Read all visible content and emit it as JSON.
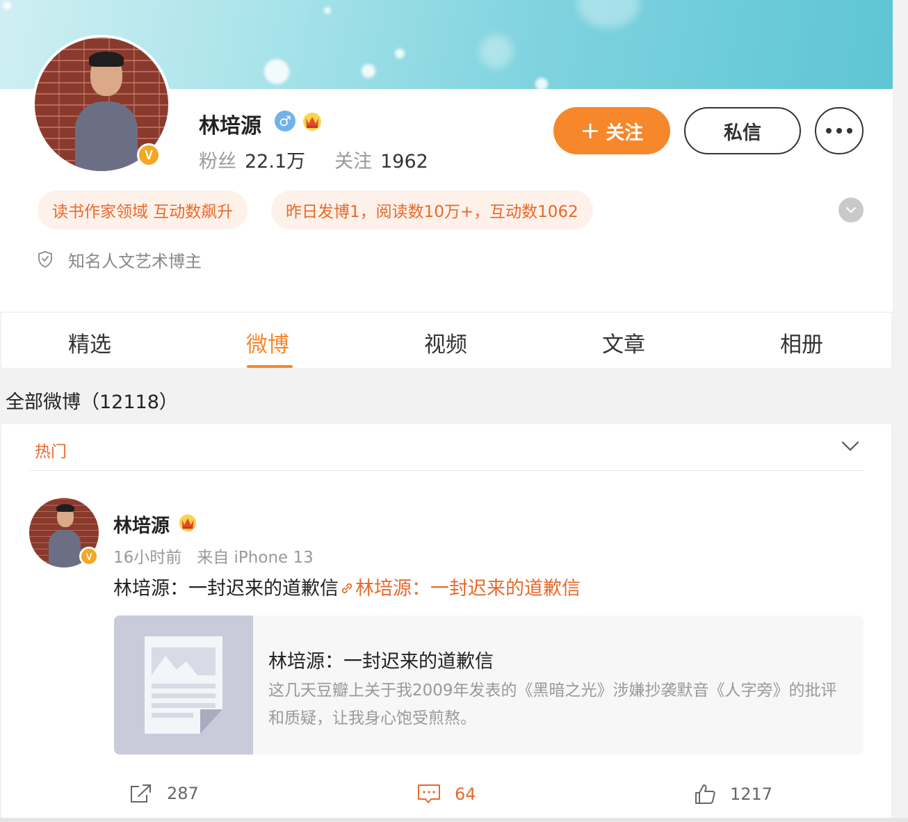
{
  "profile": {
    "name": "林培源",
    "gender_icon": "♂",
    "verified_mark": "V",
    "fans_label": "粉丝",
    "fans_value": "22.1万",
    "follow_label": "关注",
    "follow_value": "1962",
    "description": "知名人文艺术博主"
  },
  "actions": {
    "follow_plus": "+",
    "follow_label": "关注",
    "message_label": "私信"
  },
  "tags": [
    "读书作家领域 互动数飙升",
    "昨日发博1，阅读数10万+，互动数1062"
  ],
  "tabs": [
    "精选",
    "微博",
    "视频",
    "文章",
    "相册"
  ],
  "active_tab": "微博",
  "feed": {
    "title": "全部微博（12118）",
    "filter_label": "热门",
    "post": {
      "author": "林培源",
      "verified_mark": "V",
      "time": "16小时前",
      "source": "来自 iPhone 13",
      "text": "林培源：一封迟来的道歉信",
      "link_text": "林培源：一封迟来的道歉信",
      "card_title": "林培源：一封迟来的道歉信",
      "card_desc": "这几天豆瓣上关于我2009年发表的《黑暗之光》涉嫌抄袭默音《人字旁》的批评和质疑，让我身心饱受煎熬。",
      "reposts": "287",
      "comments": "64",
      "likes": "1217"
    }
  },
  "colors": {
    "accent": "#f6872b",
    "tag_bg": "#fdf1ea",
    "link": "#e8692a"
  }
}
